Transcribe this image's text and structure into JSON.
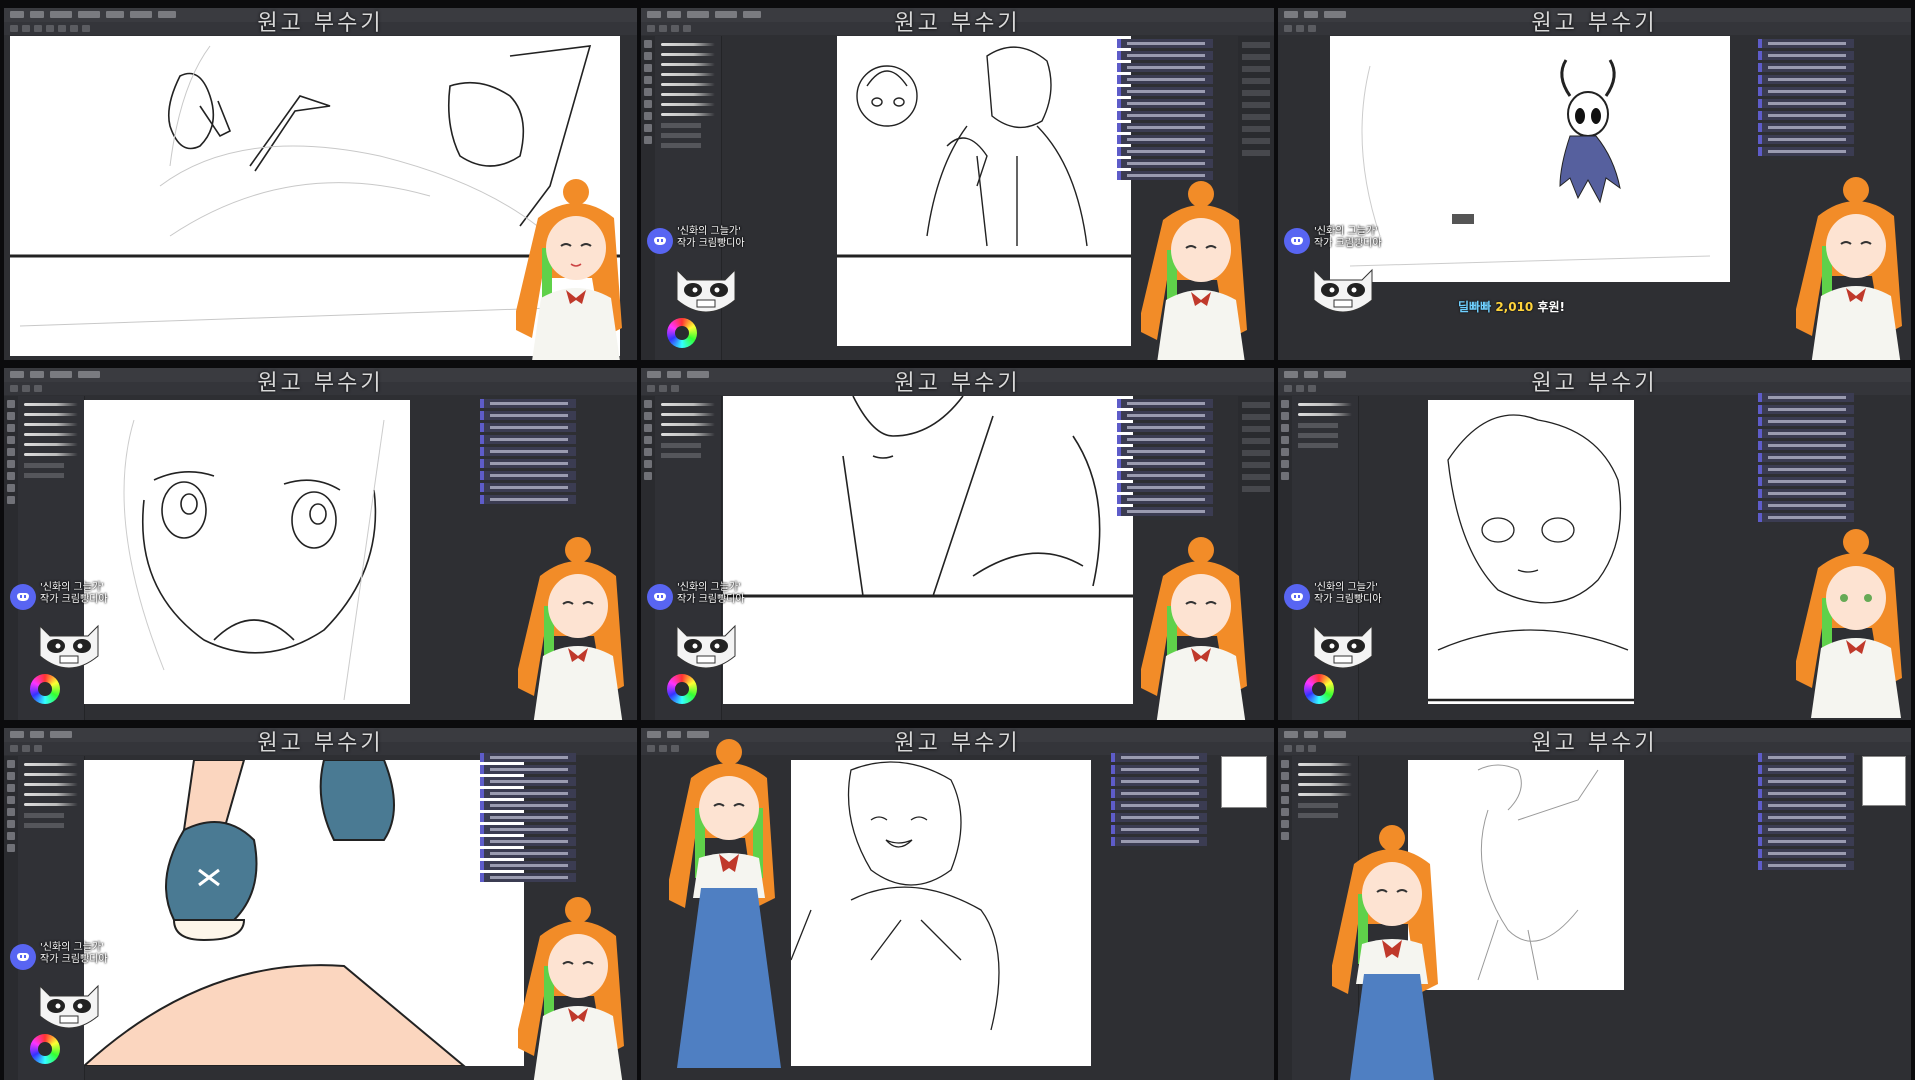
{
  "stream_title": "원고 부수기",
  "discord_label": {
    "line1": "'신화의 그늘가'",
    "line2": "작가 크림빵디아"
  },
  "donation": {
    "prefix": "딜빠빠",
    "amount": "2,010",
    "suffix": "후원!"
  },
  "panels": [
    {
      "id": "p1",
      "title": "원고 부수기"
    },
    {
      "id": "p2",
      "title": "원고 부수기"
    },
    {
      "id": "p3",
      "title": "원고 부수기"
    },
    {
      "id": "p4",
      "title": "원고 부수기"
    },
    {
      "id": "p5",
      "title": "원고 부수기"
    },
    {
      "id": "p6",
      "title": "원고 부수기"
    },
    {
      "id": "p7",
      "title": "원고 부수기"
    },
    {
      "id": "p8",
      "title": "원고 부수기"
    },
    {
      "id": "p9",
      "title": "원고 부수기"
    }
  ],
  "colors": {
    "background": "#0b0b0d",
    "app_panel": "#2e2f33",
    "chat_accent": "#5e5cc9",
    "discord": "#5865f2",
    "hair": "#f28c28",
    "hair_streak": "#5fd14a",
    "donation_text": "#ffd43b"
  }
}
